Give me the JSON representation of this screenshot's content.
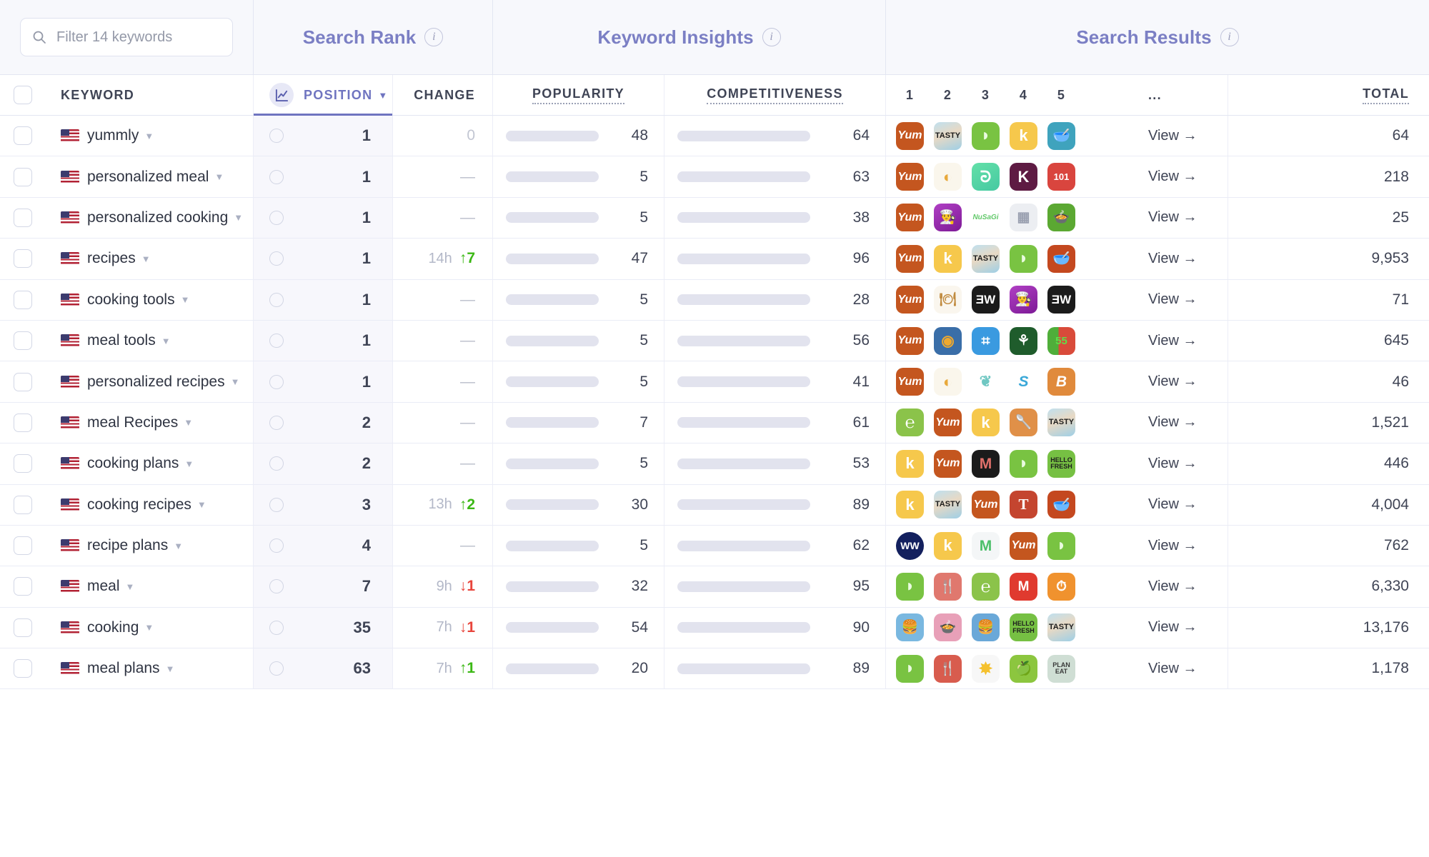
{
  "filter": {
    "placeholder": "Filter 14 keywords",
    "icon": "search-icon"
  },
  "groups": [
    {
      "title": "Search Rank",
      "info": "i"
    },
    {
      "title": "Keyword Insights",
      "info": "i"
    },
    {
      "title": "Search Results",
      "info": "i"
    }
  ],
  "columns": {
    "keyword": "KEYWORD",
    "position": "POSITION",
    "change": "CHANGE",
    "popularity": "POPULARITY",
    "competitiveness": "COMPETITIVENESS",
    "rank1": "1",
    "rank2": "2",
    "rank3": "3",
    "rank4": "4",
    "rank5": "5",
    "more": "...",
    "total": "TOTAL"
  },
  "view_label": "View →",
  "colors": {
    "accent": "#6f74c0",
    "bar": "#7479c4",
    "bar_track": "#e2e3ee",
    "up": "#3cb815",
    "down": "#e8453c"
  },
  "rows": [
    {
      "keyword": "yummly",
      "position": "1",
      "change_time": "",
      "change_value": "0",
      "change_dir": "zero",
      "popularity": 48,
      "popularity_label": "48",
      "competitiveness": 64,
      "competitiveness_label": "64",
      "total": "64",
      "apps": [
        "Yum",
        "TASTY",
        "lime",
        "foodK",
        "bowl"
      ]
    },
    {
      "keyword": "personalized meal",
      "position": "1",
      "change_time": "",
      "change_value": "—",
      "change_dir": "dash",
      "popularity": 5,
      "popularity_label": "5",
      "competitiveness": 63,
      "competitiveness_label": "63",
      "total": "218",
      "apps": [
        "Yum",
        "dots",
        "greenleaf",
        "K",
        "101"
      ]
    },
    {
      "keyword": "personalized cooking",
      "position": "1",
      "change_time": "",
      "change_value": "—",
      "change_dir": "dash",
      "popularity": 5,
      "popularity_label": "5",
      "competitiveness": 38,
      "competitiveness_label": "38",
      "total": "25",
      "apps": [
        "Yum",
        "chefmouse",
        "NuSaGi",
        "folder",
        "pot"
      ]
    },
    {
      "keyword": "recipes",
      "position": "1",
      "change_time": "14h",
      "change_value": "7",
      "change_dir": "up",
      "popularity": 47,
      "popularity_label": "47",
      "competitiveness": 96,
      "competitiveness_label": "96",
      "total": "9,953",
      "apps": [
        "Yum",
        "foodK",
        "TASTY",
        "lime",
        "bowlred"
      ]
    },
    {
      "keyword": "cooking tools",
      "position": "1",
      "change_time": "",
      "change_value": "—",
      "change_dir": "dash",
      "popularity": 5,
      "popularity_label": "5",
      "competitiveness": 28,
      "competitiveness_label": "28",
      "total": "71",
      "apps": [
        "Yum",
        "platter",
        "3wlite",
        "chefmouse",
        "3w"
      ]
    },
    {
      "keyword": "meal tools",
      "position": "1",
      "change_time": "",
      "change_value": "—",
      "change_dir": "dash",
      "popularity": 5,
      "popularity_label": "5",
      "competitiveness": 56,
      "competitiveness_label": "56",
      "total": "645",
      "apps": [
        "Yum",
        "bluedot",
        "bluetool",
        "deer",
        "timer55"
      ]
    },
    {
      "keyword": "personalized recipes",
      "position": "1",
      "change_time": "",
      "change_value": "—",
      "change_dir": "dash",
      "popularity": 5,
      "popularity_label": "5",
      "competitiveness": 41,
      "competitiveness_label": "41",
      "total": "46",
      "apps": [
        "Yum",
        "dots",
        "blobs",
        "S",
        "B"
      ]
    },
    {
      "keyword": "meal Recipes",
      "position": "2",
      "change_time": "",
      "change_value": "—",
      "change_dir": "dash",
      "popularity": 7,
      "popularity_label": "7",
      "competitiveness": 61,
      "competitiveness_label": "61",
      "total": "1,521",
      "apps": [
        "eat",
        "Yum",
        "foodK",
        "whisk",
        "TASTY"
      ]
    },
    {
      "keyword": "cooking plans",
      "position": "2",
      "change_time": "",
      "change_value": "—",
      "change_dir": "dash",
      "popularity": 5,
      "popularity_label": "5",
      "competitiveness": 53,
      "competitiveness_label": "53",
      "total": "446",
      "apps": [
        "foodK",
        "Yum",
        "Mblack",
        "lime",
        "hellofresh"
      ]
    },
    {
      "keyword": "cooking recipes",
      "position": "3",
      "change_time": "13h",
      "change_value": "2",
      "change_dir": "up",
      "popularity": 30,
      "popularity_label": "30",
      "competitiveness": 89,
      "competitiveness_label": "89",
      "total": "4,004",
      "apps": [
        "foodK",
        "TASTY",
        "Yum",
        "nyt",
        "bowlred"
      ]
    },
    {
      "keyword": "recipe plans",
      "position": "4",
      "change_time": "",
      "change_value": "—",
      "change_dir": "dash",
      "popularity": 5,
      "popularity_label": "5",
      "competitiveness": 62,
      "competitiveness_label": "62",
      "total": "762",
      "apps": [
        "ww",
        "foodK",
        "mealime",
        "Yum",
        "lime"
      ]
    },
    {
      "keyword": "meal",
      "position": "7",
      "change_time": "9h",
      "change_value": "1",
      "change_dir": "down",
      "popularity": 32,
      "popularity_label": "32",
      "competitiveness": 95,
      "competitiveness_label": "95",
      "total": "6,330",
      "apps": [
        "lime",
        "forkknife",
        "eat",
        "Mred",
        "scale"
      ]
    },
    {
      "keyword": "cooking",
      "position": "35",
      "change_time": "7h",
      "change_value": "1",
      "change_dir": "down",
      "popularity": 54,
      "popularity_label": "54",
      "competitiveness": 90,
      "competitiveness_label": "90",
      "total": "13,176",
      "apps": [
        "burger1",
        "burger2",
        "burger3",
        "hellofresh",
        "TASTY"
      ]
    },
    {
      "keyword": "meal plans",
      "position": "63",
      "change_time": "7h",
      "change_value": "1",
      "change_dir": "up",
      "popularity": 20,
      "popularity_label": "20",
      "competitiveness": 89,
      "competitiveness_label": "89",
      "total": "1,178",
      "apps": [
        "lime",
        "forkknife2",
        "sun",
        "apple",
        "planeat"
      ]
    }
  ]
}
